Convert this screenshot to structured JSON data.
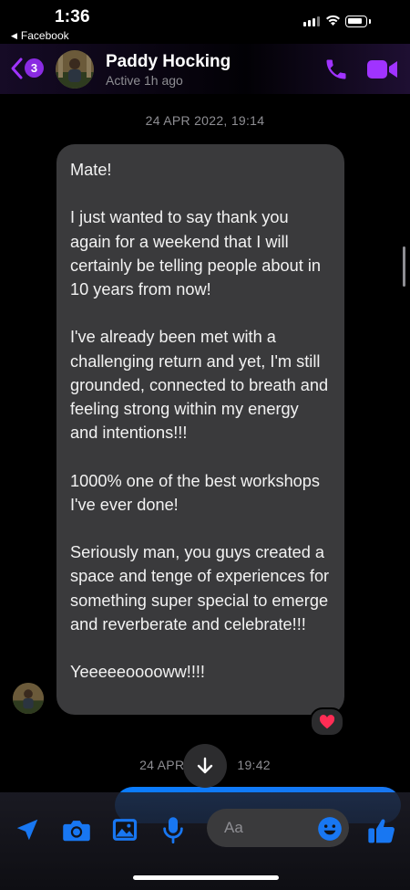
{
  "status_bar": {
    "time": "1:36",
    "back_app": "Facebook"
  },
  "header": {
    "unread_badge": "3",
    "contact_name": "Paddy Hocking",
    "contact_status": "Active 1h ago"
  },
  "chat": {
    "timestamp_1": "24 APR 2022, 19:14",
    "message_paragraphs": [
      "Mate!",
      "I just wanted to say thank you again for a weekend that I will certainly be telling people about in 10 years from now!",
      "I've already been met with a challenging return and yet, I'm still grounded, connected to breath and feeling strong within my energy and intentions!!!",
      "1000% one of the best workshops I've ever done!",
      "Seriously man, you guys created a space and tenge of experiences for something super special to emerge and reverberate and celebrate!!!",
      "Yeeeeeooooww!!!!"
    ],
    "reaction": "heart",
    "timestamp_2_left": "24 APR",
    "timestamp_2_right": "19:42"
  },
  "composer": {
    "placeholder": "Aa",
    "icons": [
      "location-icon",
      "camera-icon",
      "gallery-icon",
      "microphone-icon",
      "emoji-icon",
      "thumbs-up-icon"
    ]
  },
  "colors": {
    "accent": "#a033ff",
    "bubble_incoming": "#3a3a3c",
    "bubble_outgoing": "#0a7cff",
    "composer_icon": "#1877f2"
  }
}
